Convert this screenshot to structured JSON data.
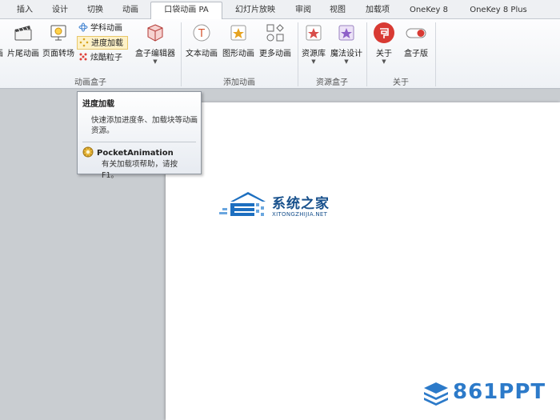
{
  "tabs": [
    "插入",
    "设计",
    "切换",
    "动画",
    "口袋动画 PA",
    "幻灯片放映",
    "审阅",
    "视图",
    "加载项",
    "OneKey 8",
    "OneKey 8 Plus"
  ],
  "active_tab": "口袋动画 PA",
  "ribbon": {
    "groups": {
      "anim_box": "动画盒子",
      "add_anim": "添加动画",
      "resource_box": "资源盒子",
      "about": "关于"
    },
    "buttons": {
      "tail_anim": "片尾动画",
      "tail_anim_prefix": "画",
      "page_transition": "页面转场",
      "subject_anim": "学科动画",
      "progress_load": "进度加载",
      "dazzle_particle": "炫酷粒子",
      "box_editor": "盒子编辑器",
      "text_anim": "文本动画",
      "shape_anim": "图形动画",
      "more_anim": "更多动画",
      "resource_lib": "资源库",
      "magic_design": "魔法设计",
      "about": "关于",
      "box_edition": "盒子版"
    }
  },
  "tooltip": {
    "title": "进度加载",
    "description": "快速添加进度条、加载块等动画资源。",
    "app_name": "PocketAnimation",
    "help": "有关加载项帮助，请按 F1。"
  },
  "watermarks": {
    "cn_brand": "系统之家",
    "cn_url": "XITONGZHIJIA.NET",
    "ppt_brand": "861PPT"
  },
  "colors": {
    "accent": "#c8302c",
    "brand_blue": "#17508c",
    "ppt_blue": "#2c7ac9",
    "hover": "#fdf1c7"
  }
}
